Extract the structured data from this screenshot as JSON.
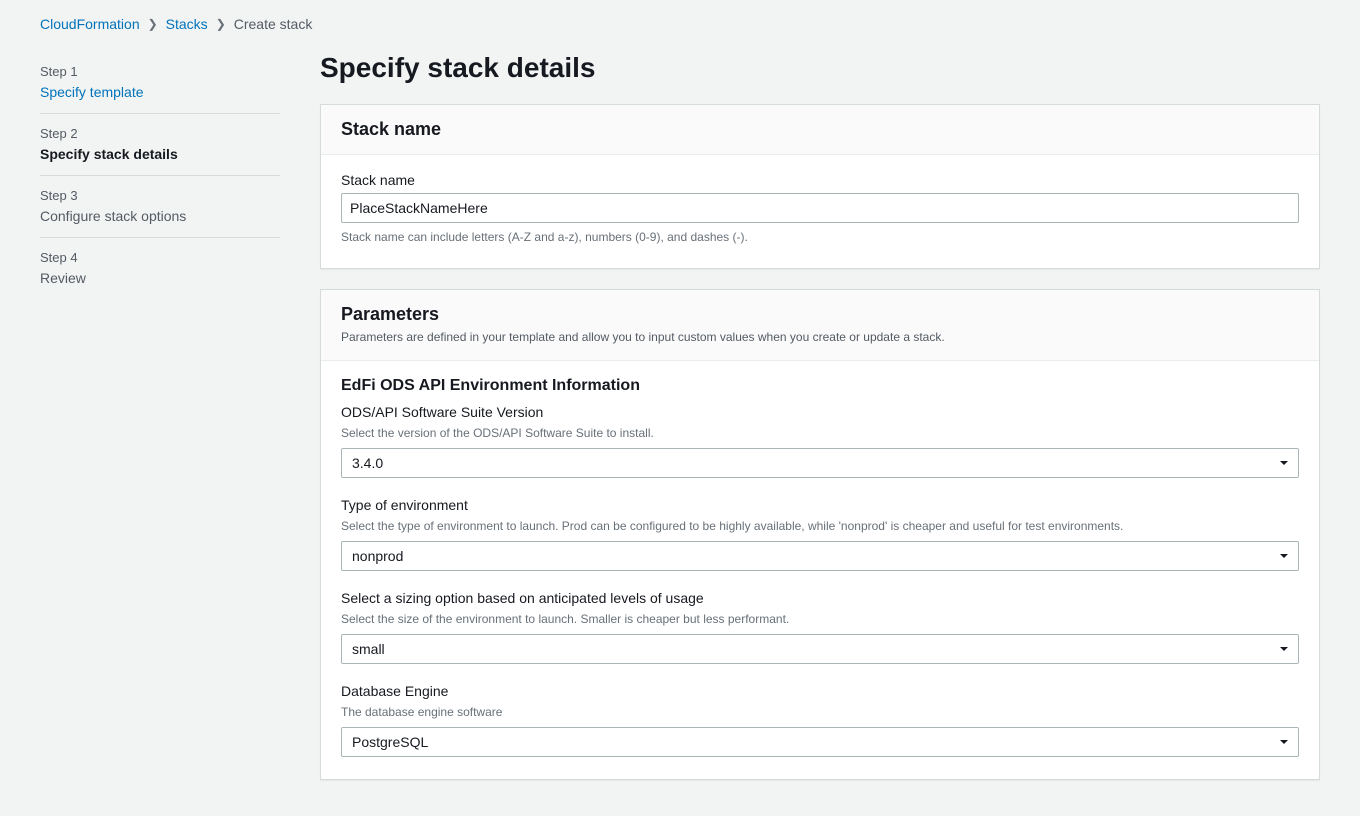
{
  "breadcrumb": {
    "items": [
      {
        "label": "CloudFormation",
        "link": true
      },
      {
        "label": "Stacks",
        "link": true
      },
      {
        "label": "Create stack",
        "link": false
      }
    ]
  },
  "sidebar": {
    "steps": [
      {
        "num": "Step 1",
        "title": "Specify template",
        "state": "link"
      },
      {
        "num": "Step 2",
        "title": "Specify stack details",
        "state": "current"
      },
      {
        "num": "Step 3",
        "title": "Configure stack options",
        "state": ""
      },
      {
        "num": "Step 4",
        "title": "Review",
        "state": ""
      }
    ]
  },
  "main": {
    "title": "Specify stack details",
    "stack_panel": {
      "header": "Stack name",
      "label": "Stack name",
      "value": "PlaceStackNameHere",
      "hint": "Stack name can include letters (A-Z and a-z), numbers (0-9), and dashes (-)."
    },
    "params_panel": {
      "header": "Parameters",
      "subtitle": "Parameters are defined in your template and allow you to input custom values when you create or update a stack.",
      "section": "EdFi ODS API Environment Information",
      "fields": [
        {
          "label": "ODS/API Software Suite Version",
          "hint": "Select the version of the ODS/API Software Suite to install.",
          "value": "3.4.0"
        },
        {
          "label": "Type of environment",
          "hint": "Select the type of environment to launch. Prod can be configured to be highly available, while 'nonprod' is cheaper and useful for test environments.",
          "value": "nonprod"
        },
        {
          "label": "Select a sizing option based on anticipated levels of usage",
          "hint": "Select the size of the environment to launch. Smaller is cheaper but less performant.",
          "value": "small"
        },
        {
          "label": "Database Engine",
          "hint": "The database engine software",
          "value": "PostgreSQL"
        }
      ]
    }
  }
}
